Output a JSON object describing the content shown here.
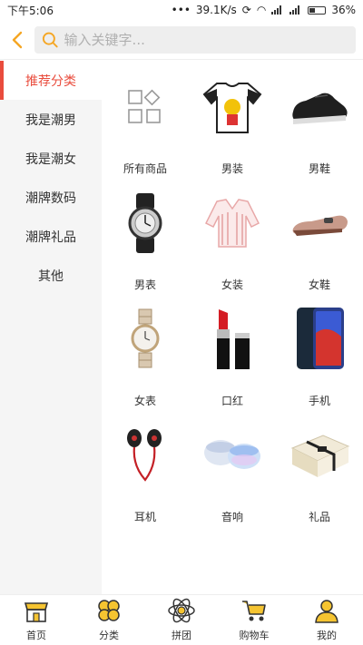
{
  "status": {
    "time": "下午5:06",
    "speed": "39.1K/s",
    "battery": "36%"
  },
  "search": {
    "placeholder": "输入关键字..."
  },
  "sidebar": {
    "items": [
      {
        "label": "推荐分类"
      },
      {
        "label": "我是潮男"
      },
      {
        "label": "我是潮女"
      },
      {
        "label": "潮牌数码"
      },
      {
        "label": "潮牌礼品"
      },
      {
        "label": "其他"
      }
    ]
  },
  "grid": {
    "items": [
      {
        "label": "所有商品",
        "icon": "all-products-icon"
      },
      {
        "label": "男装",
        "icon": "tshirt-icon"
      },
      {
        "label": "男鞋",
        "icon": "mens-shoe-icon"
      },
      {
        "label": "男表",
        "icon": "mens-watch-icon"
      },
      {
        "label": "女装",
        "icon": "blouse-icon"
      },
      {
        "label": "女鞋",
        "icon": "flat-shoe-icon"
      },
      {
        "label": "女表",
        "icon": "womens-watch-icon"
      },
      {
        "label": "口红",
        "icon": "lipstick-icon"
      },
      {
        "label": "手机",
        "icon": "phone-icon"
      },
      {
        "label": "耳机",
        "icon": "earphones-icon"
      },
      {
        "label": "音响",
        "icon": "speaker-icon"
      },
      {
        "label": "礼品",
        "icon": "gift-box-icon"
      }
    ]
  },
  "tabbar": {
    "items": [
      {
        "label": "首页",
        "icon": "home-store-icon"
      },
      {
        "label": "分类",
        "icon": "category-clover-icon"
      },
      {
        "label": "拼团",
        "icon": "group-atom-icon"
      },
      {
        "label": "购物车",
        "icon": "cart-icon"
      },
      {
        "label": "我的",
        "icon": "user-icon"
      }
    ]
  },
  "colors": {
    "accent": "#e94c3d",
    "brand_yellow": "#f5a623"
  }
}
